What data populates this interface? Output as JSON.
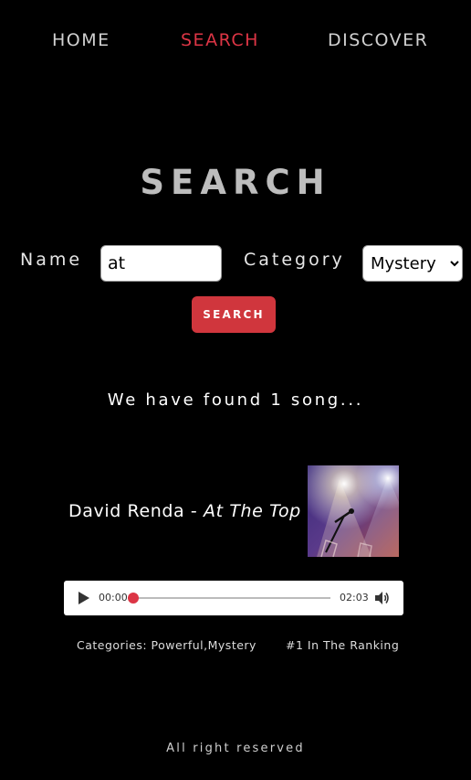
{
  "nav": {
    "home": "HOME",
    "search": "SEARCH",
    "discover": "DISCOVER",
    "active_color": "#dc3545"
  },
  "page_title": "SEARCH",
  "form": {
    "name_label": "Name",
    "name_value": "at",
    "category_label": "Category",
    "category_selected": "Mystery",
    "search_button": "SEARCH"
  },
  "results": {
    "summary": "We have found 1 song...",
    "song": {
      "artist": "David Renda",
      "separator": " - ",
      "title": "At The Top",
      "cover_icon": "stage-spotlight-image",
      "player": {
        "current_time": "00:00",
        "duration": "02:03",
        "progress": 0
      },
      "categories_text": "Categories: Powerful,Mystery",
      "ranking_text": "#1 In The Ranking"
    }
  },
  "footer": "All right reserved",
  "colors": {
    "background": "#000000",
    "accent": "#dc3545",
    "title_gray": "#bdbdbd"
  }
}
